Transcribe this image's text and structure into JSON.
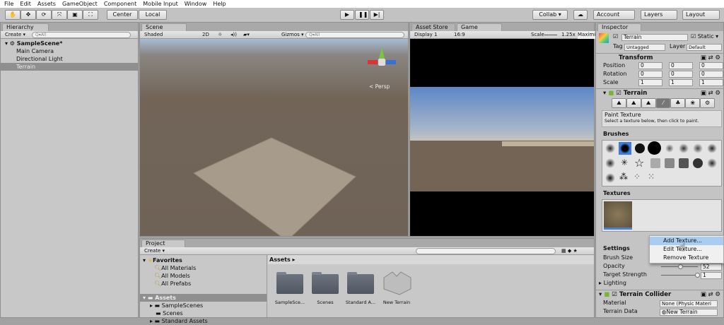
{
  "menu": [
    "File",
    "Edit",
    "Assets",
    "GameObject",
    "Component",
    "Mobile Input",
    "Window",
    "Help"
  ],
  "toolbar": {
    "center": "Center",
    "local": "Local",
    "collab": "Collab ▾",
    "account": "Account",
    "layers": "Layers",
    "layout": "Layout"
  },
  "hierarchy": {
    "tab": "Hierarchy",
    "create": "Create ▾",
    "search_placeholder": "Q▾All",
    "scene": "SampleScene*",
    "items": [
      "Main Camera",
      "Directional Light",
      "Terrain"
    ]
  },
  "scene": {
    "tab": "Scene",
    "shading": "Shaded",
    "mode2d": "2D",
    "gizmos": "Gizmos ▾",
    "search_placeholder": "Q▾All",
    "persp": "< Persp"
  },
  "game": {
    "tabs": [
      "Asset Store",
      "Game"
    ],
    "display": "Display 1",
    "aspect": "16:9",
    "scale_label": "Scale",
    "scale": "1.25x",
    "maximize": "Maximi"
  },
  "project": {
    "tab": "Project",
    "create": "Create ▾",
    "favorites": "Favorites",
    "fav_items": [
      "All Materials",
      "All Models",
      "All Prefabs"
    ],
    "assets": "Assets",
    "asset_tree": [
      "SampleScenes",
      "Scenes",
      "Standard Assets"
    ],
    "breadcrumb": "Assets ▸",
    "files": [
      "SampleSce...",
      "Scenes",
      "Standard A...",
      "New Terrain"
    ]
  },
  "inspector": {
    "tab": "Inspector",
    "name": "Terrain",
    "static": "Static ▾",
    "tag_label": "Tag",
    "tag": "Untagged",
    "layer_label": "Layer",
    "layer": "Default",
    "transform": {
      "title": "Transform",
      "rows": [
        {
          "label": "Position",
          "x": "0",
          "y": "0",
          "z": "0"
        },
        {
          "label": "Rotation",
          "x": "0",
          "y": "0",
          "z": "0"
        },
        {
          "label": "Scale",
          "x": "1",
          "y": "1",
          "z": "1"
        }
      ]
    },
    "terrain": {
      "title": "Terrain",
      "tool_title": "Paint Texture",
      "tool_help": "Select a texture below, then click to paint.",
      "brushes": "Brushes",
      "textures": "Textures"
    },
    "settings": {
      "title": "Settings",
      "brush_size": "Brush Size",
      "opacity": "Opacity",
      "opacity_val": "52",
      "strength": "Target Strength",
      "strength_val": "1",
      "lighting": "Lighting"
    },
    "collider": {
      "title": "Terrain Collider",
      "material_label": "Material",
      "material": "None (Physic Materi",
      "data_label": "Terrain Data",
      "data": "New Terrain"
    }
  },
  "context_menu": [
    "Add Texture...",
    "Edit Texture...",
    "Remove Texture"
  ],
  "colors": {
    "selection": "#8f8f8f",
    "menu_highlight": "#a9cdf0",
    "scene_ground": "#716459",
    "sky": "#6f93c9"
  }
}
